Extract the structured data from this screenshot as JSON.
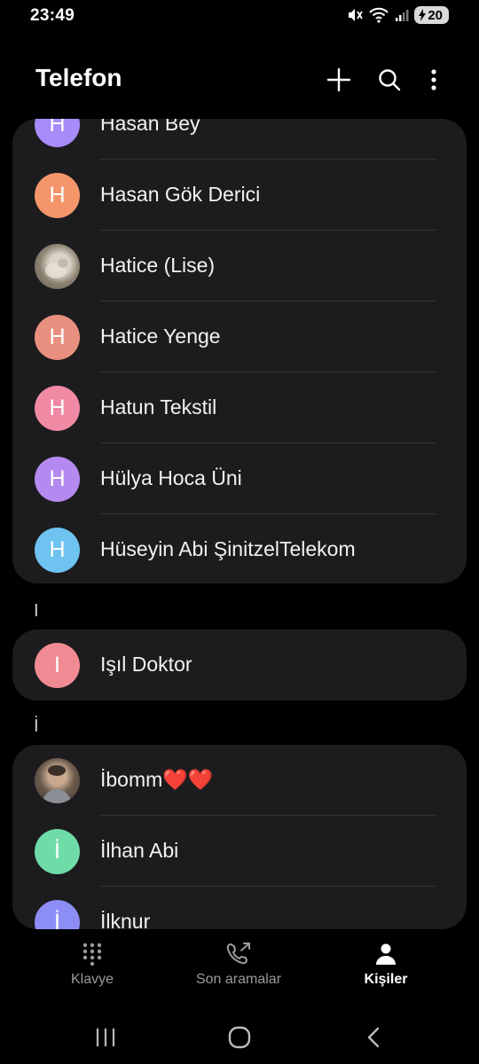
{
  "status_bar": {
    "time": "23:49",
    "battery": "20"
  },
  "app_bar": {
    "title": "Telefon"
  },
  "contacts": {
    "card_h": [
      {
        "name": "Hasan Bey",
        "initial": "H",
        "color": "#a78bfa"
      },
      {
        "name": "Hasan Gök Derici",
        "initial": "H",
        "color": "#f4956a"
      },
      {
        "name": "Hatice (Lise)",
        "initial": "",
        "color": "#8a8477",
        "photo": true
      },
      {
        "name": "Hatice Yenge",
        "initial": "H",
        "color": "#e98f7f"
      },
      {
        "name": "Hatun Tekstil",
        "initial": "H",
        "color": "#f08aa4"
      },
      {
        "name": "Hülya Hoca Üni",
        "initial": "H",
        "color": "#b58af0"
      },
      {
        "name": "Hüseyin Abi ŞinitzelTelekom",
        "initial": "H",
        "color": "#6ec3f0"
      }
    ],
    "section_I": "I",
    "card_I": [
      {
        "name": "Işıl Doktor",
        "initial": "I",
        "color": "#f08a93"
      }
    ],
    "section_Idot": "İ",
    "card_Idot": [
      {
        "name": "İbomm❤️❤️",
        "initial": "",
        "color": "#7a6d63",
        "photo": true
      },
      {
        "name": "İlhan Abi",
        "initial": "İ",
        "color": "#6fdca8"
      },
      {
        "name": "İlknur",
        "initial": "İ",
        "color": "#8d8ef5"
      }
    ]
  },
  "bottom_nav": {
    "tabs": [
      {
        "label": "Klavye",
        "icon": "dialpad-icon"
      },
      {
        "label": "Son aramalar",
        "icon": "recent-calls-icon"
      },
      {
        "label": "Kişiler",
        "icon": "contacts-person-icon",
        "active": true
      }
    ]
  },
  "colors": {
    "background": "#000000",
    "card": "#1c1c1e",
    "divider": "#333336"
  }
}
